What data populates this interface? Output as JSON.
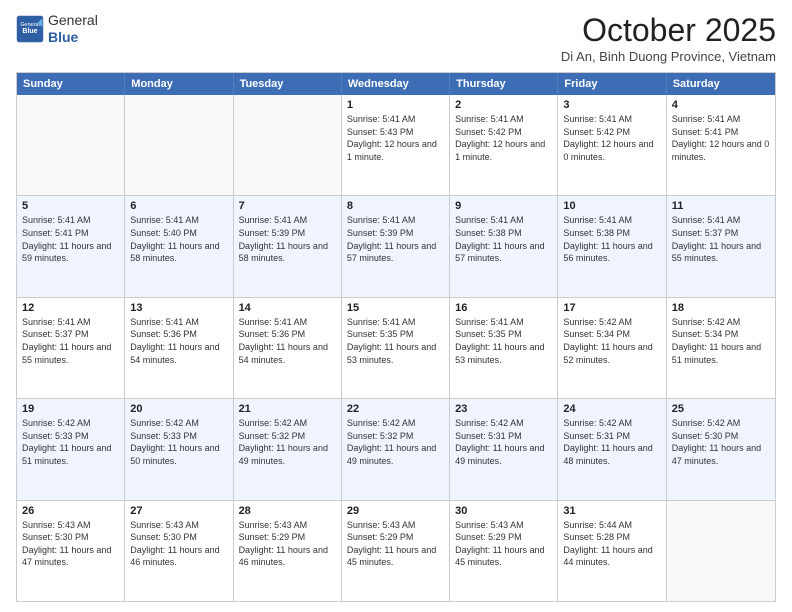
{
  "logo": {
    "general": "General",
    "blue": "Blue"
  },
  "header": {
    "month": "October 2025",
    "location": "Di An, Binh Duong Province, Vietnam"
  },
  "days": [
    "Sunday",
    "Monday",
    "Tuesday",
    "Wednesday",
    "Thursday",
    "Friday",
    "Saturday"
  ],
  "rows": [
    [
      {
        "day": "",
        "empty": true
      },
      {
        "day": "",
        "empty": true
      },
      {
        "day": "",
        "empty": true
      },
      {
        "day": "1",
        "sunrise": "5:41 AM",
        "sunset": "5:43 PM",
        "daylight": "12 hours and 1 minute."
      },
      {
        "day": "2",
        "sunrise": "5:41 AM",
        "sunset": "5:42 PM",
        "daylight": "12 hours and 1 minute."
      },
      {
        "day": "3",
        "sunrise": "5:41 AM",
        "sunset": "5:42 PM",
        "daylight": "12 hours and 0 minutes."
      },
      {
        "day": "4",
        "sunrise": "5:41 AM",
        "sunset": "5:41 PM",
        "daylight": "12 hours and 0 minutes."
      }
    ],
    [
      {
        "day": "5",
        "sunrise": "5:41 AM",
        "sunset": "5:41 PM",
        "daylight": "11 hours and 59 minutes."
      },
      {
        "day": "6",
        "sunrise": "5:41 AM",
        "sunset": "5:40 PM",
        "daylight": "11 hours and 58 minutes."
      },
      {
        "day": "7",
        "sunrise": "5:41 AM",
        "sunset": "5:39 PM",
        "daylight": "11 hours and 58 minutes."
      },
      {
        "day": "8",
        "sunrise": "5:41 AM",
        "sunset": "5:39 PM",
        "daylight": "11 hours and 57 minutes."
      },
      {
        "day": "9",
        "sunrise": "5:41 AM",
        "sunset": "5:38 PM",
        "daylight": "11 hours and 57 minutes."
      },
      {
        "day": "10",
        "sunrise": "5:41 AM",
        "sunset": "5:38 PM",
        "daylight": "11 hours and 56 minutes."
      },
      {
        "day": "11",
        "sunrise": "5:41 AM",
        "sunset": "5:37 PM",
        "daylight": "11 hours and 55 minutes."
      }
    ],
    [
      {
        "day": "12",
        "sunrise": "5:41 AM",
        "sunset": "5:37 PM",
        "daylight": "11 hours and 55 minutes."
      },
      {
        "day": "13",
        "sunrise": "5:41 AM",
        "sunset": "5:36 PM",
        "daylight": "11 hours and 54 minutes."
      },
      {
        "day": "14",
        "sunrise": "5:41 AM",
        "sunset": "5:36 PM",
        "daylight": "11 hours and 54 minutes."
      },
      {
        "day": "15",
        "sunrise": "5:41 AM",
        "sunset": "5:35 PM",
        "daylight": "11 hours and 53 minutes."
      },
      {
        "day": "16",
        "sunrise": "5:41 AM",
        "sunset": "5:35 PM",
        "daylight": "11 hours and 53 minutes."
      },
      {
        "day": "17",
        "sunrise": "5:42 AM",
        "sunset": "5:34 PM",
        "daylight": "11 hours and 52 minutes."
      },
      {
        "day": "18",
        "sunrise": "5:42 AM",
        "sunset": "5:34 PM",
        "daylight": "11 hours and 51 minutes."
      }
    ],
    [
      {
        "day": "19",
        "sunrise": "5:42 AM",
        "sunset": "5:33 PM",
        "daylight": "11 hours and 51 minutes."
      },
      {
        "day": "20",
        "sunrise": "5:42 AM",
        "sunset": "5:33 PM",
        "daylight": "11 hours and 50 minutes."
      },
      {
        "day": "21",
        "sunrise": "5:42 AM",
        "sunset": "5:32 PM",
        "daylight": "11 hours and 49 minutes."
      },
      {
        "day": "22",
        "sunrise": "5:42 AM",
        "sunset": "5:32 PM",
        "daylight": "11 hours and 49 minutes."
      },
      {
        "day": "23",
        "sunrise": "5:42 AM",
        "sunset": "5:31 PM",
        "daylight": "11 hours and 49 minutes."
      },
      {
        "day": "24",
        "sunrise": "5:42 AM",
        "sunset": "5:31 PM",
        "daylight": "11 hours and 48 minutes."
      },
      {
        "day": "25",
        "sunrise": "5:42 AM",
        "sunset": "5:30 PM",
        "daylight": "11 hours and 47 minutes."
      }
    ],
    [
      {
        "day": "26",
        "sunrise": "5:43 AM",
        "sunset": "5:30 PM",
        "daylight": "11 hours and 47 minutes."
      },
      {
        "day": "27",
        "sunrise": "5:43 AM",
        "sunset": "5:30 PM",
        "daylight": "11 hours and 46 minutes."
      },
      {
        "day": "28",
        "sunrise": "5:43 AM",
        "sunset": "5:29 PM",
        "daylight": "11 hours and 46 minutes."
      },
      {
        "day": "29",
        "sunrise": "5:43 AM",
        "sunset": "5:29 PM",
        "daylight": "11 hours and 45 minutes."
      },
      {
        "day": "30",
        "sunrise": "5:43 AM",
        "sunset": "5:29 PM",
        "daylight": "11 hours and 45 minutes."
      },
      {
        "day": "31",
        "sunrise": "5:44 AM",
        "sunset": "5:28 PM",
        "daylight": "11 hours and 44 minutes."
      },
      {
        "day": "",
        "empty": true
      }
    ]
  ]
}
